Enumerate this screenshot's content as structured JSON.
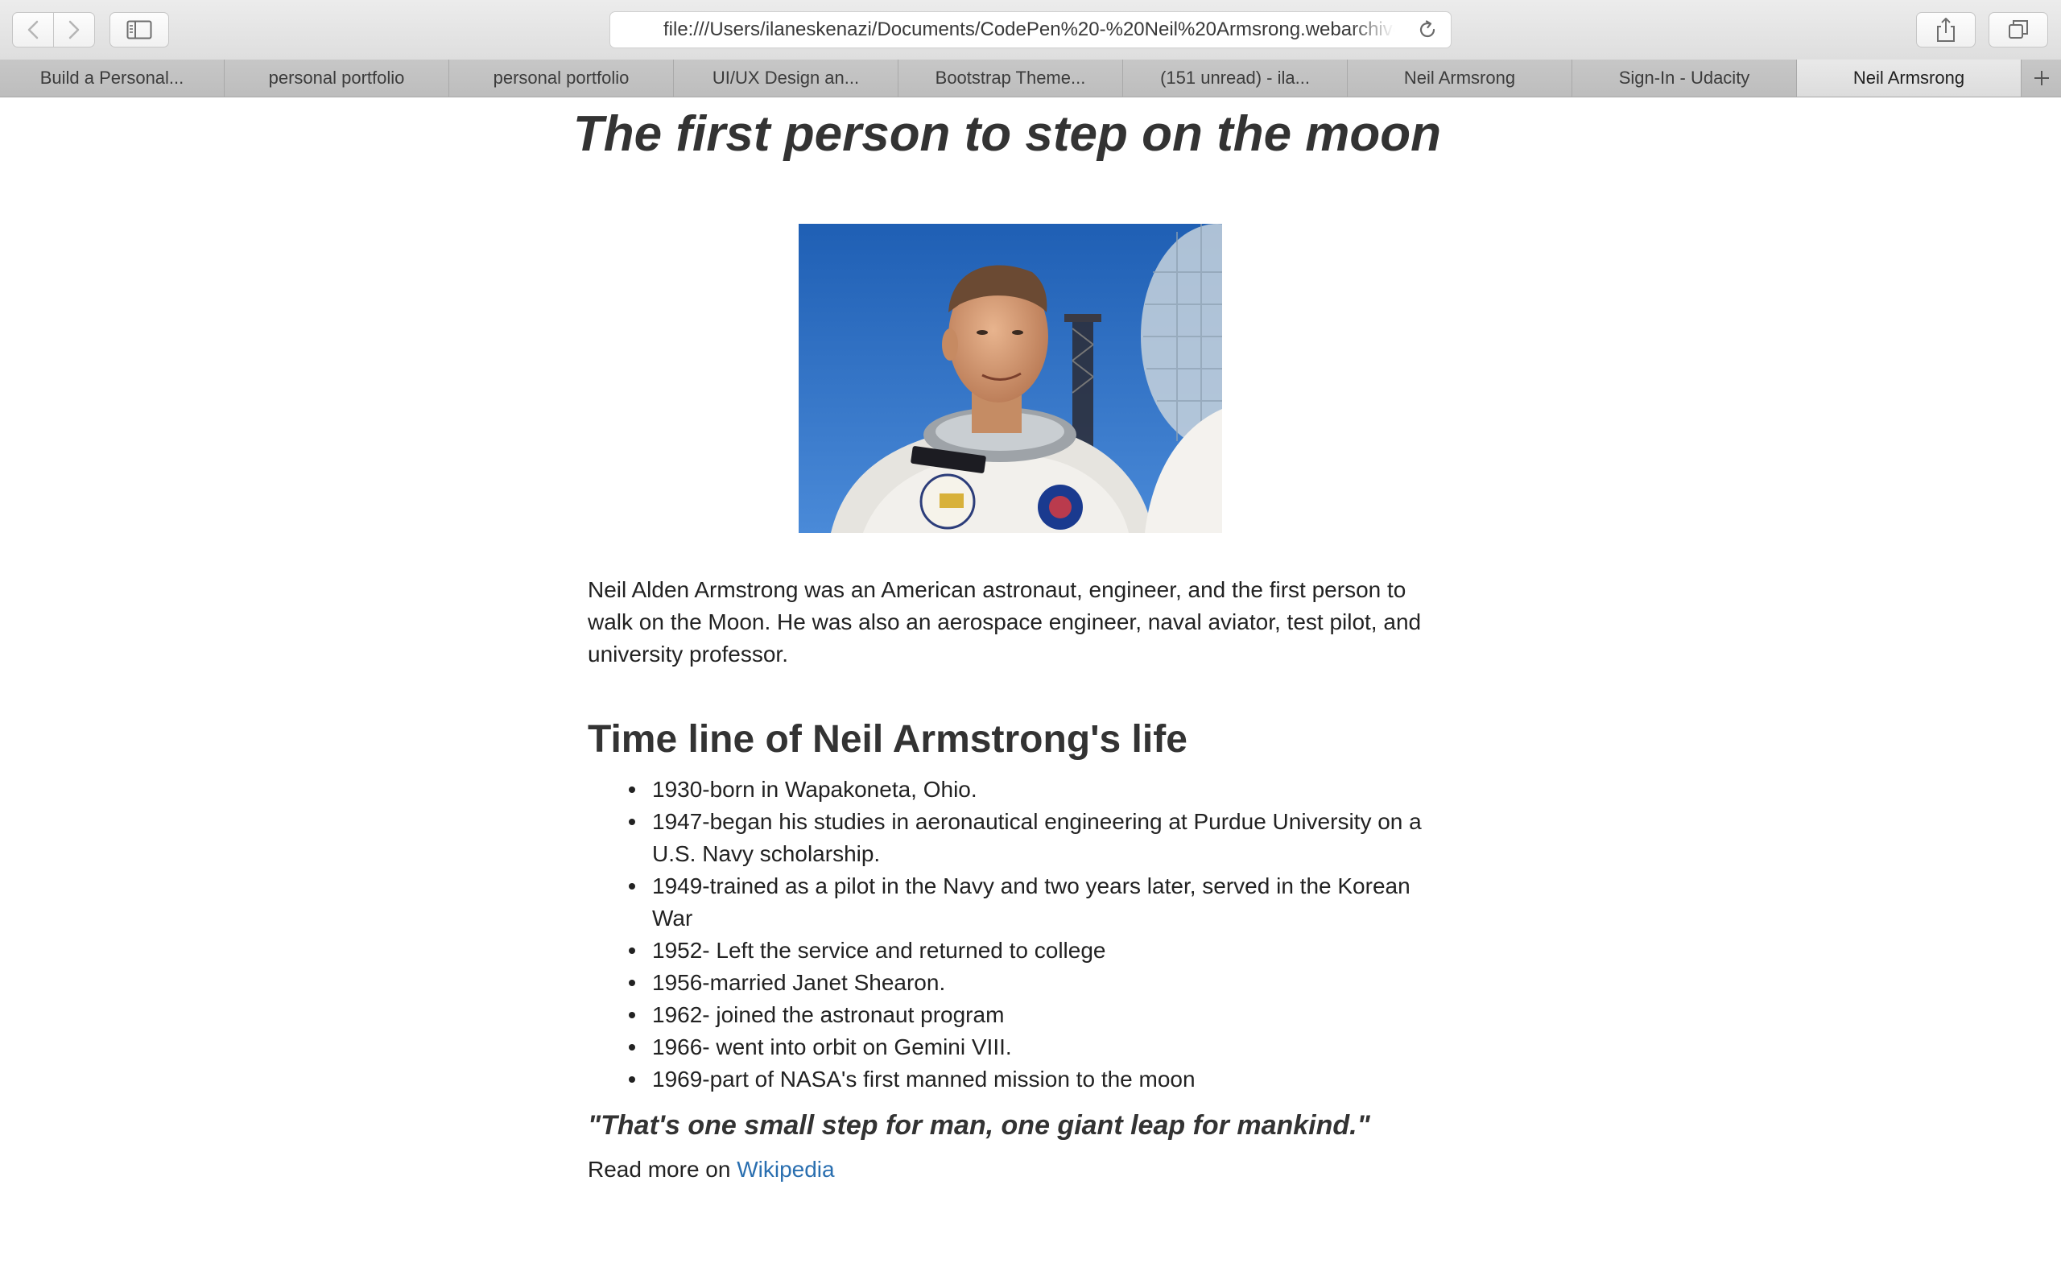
{
  "browser": {
    "url": "file:///Users/ilaneskenazi/Documents/CodePen%20-%20Neil%20Armsrong.webarchive",
    "tabs": [
      {
        "label": "Build a Personal..."
      },
      {
        "label": "personal portfolio"
      },
      {
        "label": "personal portfolio"
      },
      {
        "label": "UI/UX Design an..."
      },
      {
        "label": "Bootstrap Theme..."
      },
      {
        "label": "(151 unread) - ila..."
      },
      {
        "label": "Neil Armsrong"
      },
      {
        "label": "Sign-In - Udacity"
      },
      {
        "label": "Neil Armsrong"
      }
    ],
    "active_tab_index": 8,
    "icons": {
      "back": "chevron-left-icon",
      "forward": "chevron-right-icon",
      "sidebar": "sidebar-icon",
      "reload": "reload-icon",
      "share": "share-icon",
      "tabs": "tab-overview-icon",
      "new_tab": "plus-icon"
    }
  },
  "page": {
    "title": "The first person to step on the moon",
    "intro": "Neil Alden Armstrong was an American astronaut, engineer, and the first person to walk on the Moon. He was also an aerospace engineer, naval aviator, test pilot, and university professor.",
    "timeline_heading": "Time line of Neil Armstrong's life",
    "timeline": [
      "1930-born in Wapakoneta, Ohio.",
      "1947-began his studies in aeronautical engineering at Purdue University on a U.S. Navy scholarship.",
      "1949-trained as a pilot in the Navy and two years later, served in the Korean War",
      "1952- Left the service and returned to college",
      "1956-married Janet Shearon.",
      "1962- joined the astronaut program",
      "1966- went into orbit on Gemini VIII.",
      "1969-part of NASA's first manned mission to the moon"
    ],
    "quote": "\"That's one small step for man, one giant leap for mankind.\"",
    "readmore_prefix": "Read more on ",
    "readmore_link": "Wikipedia",
    "link_color": "#2a6fb0"
  }
}
